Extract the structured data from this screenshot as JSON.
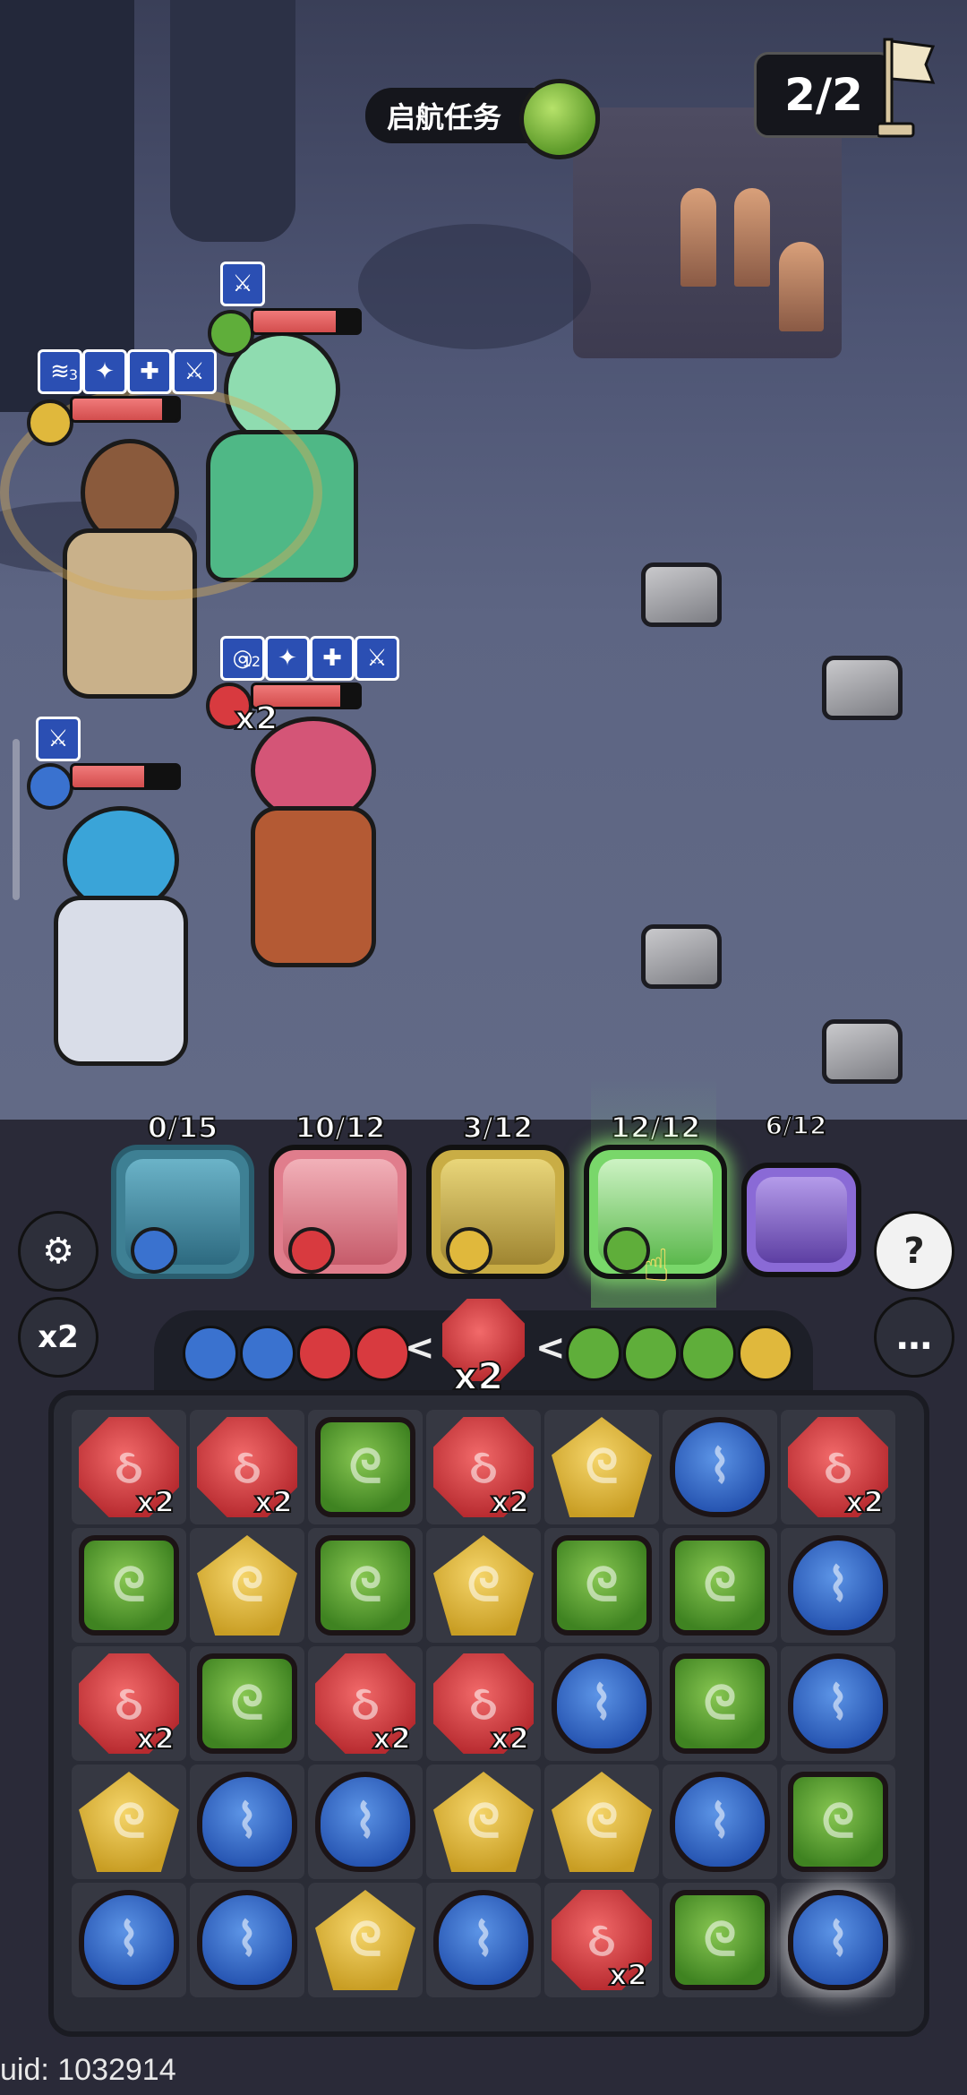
{
  "hud": {
    "quest_title": "启航任务",
    "wave_counter": "2/2"
  },
  "party": [
    {
      "name": "blue-archer",
      "charge": "0/15",
      "element": "water",
      "color": "#3a8fb0"
    },
    {
      "name": "red-engineer",
      "charge": "10/12",
      "element": "fire",
      "color": "#e06a6a"
    },
    {
      "name": "yellow-brawler",
      "charge": "3/12",
      "element": "earth",
      "color": "#d7b94a"
    },
    {
      "name": "green-elf",
      "charge": "12/12",
      "element": "wind",
      "color": "#7fd96a"
    },
    {
      "name": "purple-item",
      "charge": "6/12",
      "element": "void",
      "color": "#8a6ad6"
    }
  ],
  "buttons": {
    "speed": "x2",
    "help": "?",
    "more": "…"
  },
  "turn_order": {
    "current_multiplier": "x2",
    "left": [
      "water",
      "water",
      "fire",
      "fire"
    ],
    "current": "fire",
    "right": [
      "wind",
      "wind",
      "wind",
      "earth"
    ]
  },
  "board": [
    [
      {
        "t": "red",
        "m": "x2"
      },
      {
        "t": "red",
        "m": "x2"
      },
      {
        "t": "green"
      },
      {
        "t": "red",
        "m": "x2"
      },
      {
        "t": "yellow"
      },
      {
        "t": "blue"
      },
      {
        "t": "red",
        "m": "x2"
      }
    ],
    [
      {
        "t": "green"
      },
      {
        "t": "yellow"
      },
      {
        "t": "green"
      },
      {
        "t": "yellow"
      },
      {
        "t": "green"
      },
      {
        "t": "green"
      },
      {
        "t": "blue"
      }
    ],
    [
      {
        "t": "red",
        "m": "x2"
      },
      {
        "t": "green"
      },
      {
        "t": "red",
        "m": "x2"
      },
      {
        "t": "red",
        "m": "x2"
      },
      {
        "t": "blue"
      },
      {
        "t": "green"
      },
      {
        "t": "blue"
      }
    ],
    [
      {
        "t": "yellow"
      },
      {
        "t": "blue"
      },
      {
        "t": "blue"
      },
      {
        "t": "yellow"
      },
      {
        "t": "yellow"
      },
      {
        "t": "blue"
      },
      {
        "t": "green"
      }
    ],
    [
      {
        "t": "blue"
      },
      {
        "t": "blue"
      },
      {
        "t": "yellow",
        "s": true
      },
      {
        "t": "blue"
      },
      {
        "t": "red",
        "m": "x2",
        "s": true
      },
      {
        "t": "green"
      },
      {
        "t": "blue",
        "s": true
      }
    ]
  ],
  "battle": {
    "engineer_multiplier": "x2",
    "buff_stack_brawler": "3",
    "buff_stack_engineer": "12"
  },
  "footer": {
    "uid": "uid: 1032914"
  },
  "colors": {
    "fire": "#d83a3f",
    "wind": "#5fae3a",
    "earth": "#e0b83c",
    "water": "#3a72cf"
  }
}
